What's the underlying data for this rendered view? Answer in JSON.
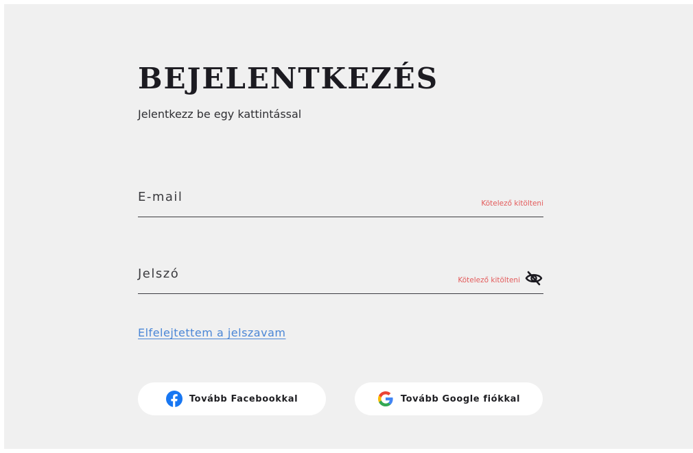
{
  "login": {
    "title": "BEJELENTKEZÉS",
    "subtitle": "Jelentkezz be egy kattintással"
  },
  "fields": {
    "email": {
      "label": "E-mail",
      "value": "",
      "required_text": "Kötelező kitölteni"
    },
    "password": {
      "label": "Jelszó",
      "value": "",
      "required_text": "Kötelező kitölteni",
      "toggle_icon": "eye-slash-icon"
    }
  },
  "links": {
    "forgot_password": "Elfelejtettem a jelszavam"
  },
  "social": {
    "facebook": {
      "label": "Tovább Facebookkal",
      "icon": "facebook-icon",
      "color": "#1877f2"
    },
    "google": {
      "label": "Tovább Google fiókkal",
      "icon": "google-icon",
      "colors": [
        "#4285f4",
        "#ea4335",
        "#fbbc05",
        "#34a853"
      ]
    }
  },
  "colors": {
    "background": "#f0f0f0",
    "required": "#e35a5a",
    "link": "#4a86d6",
    "text": "#1c1b21"
  }
}
